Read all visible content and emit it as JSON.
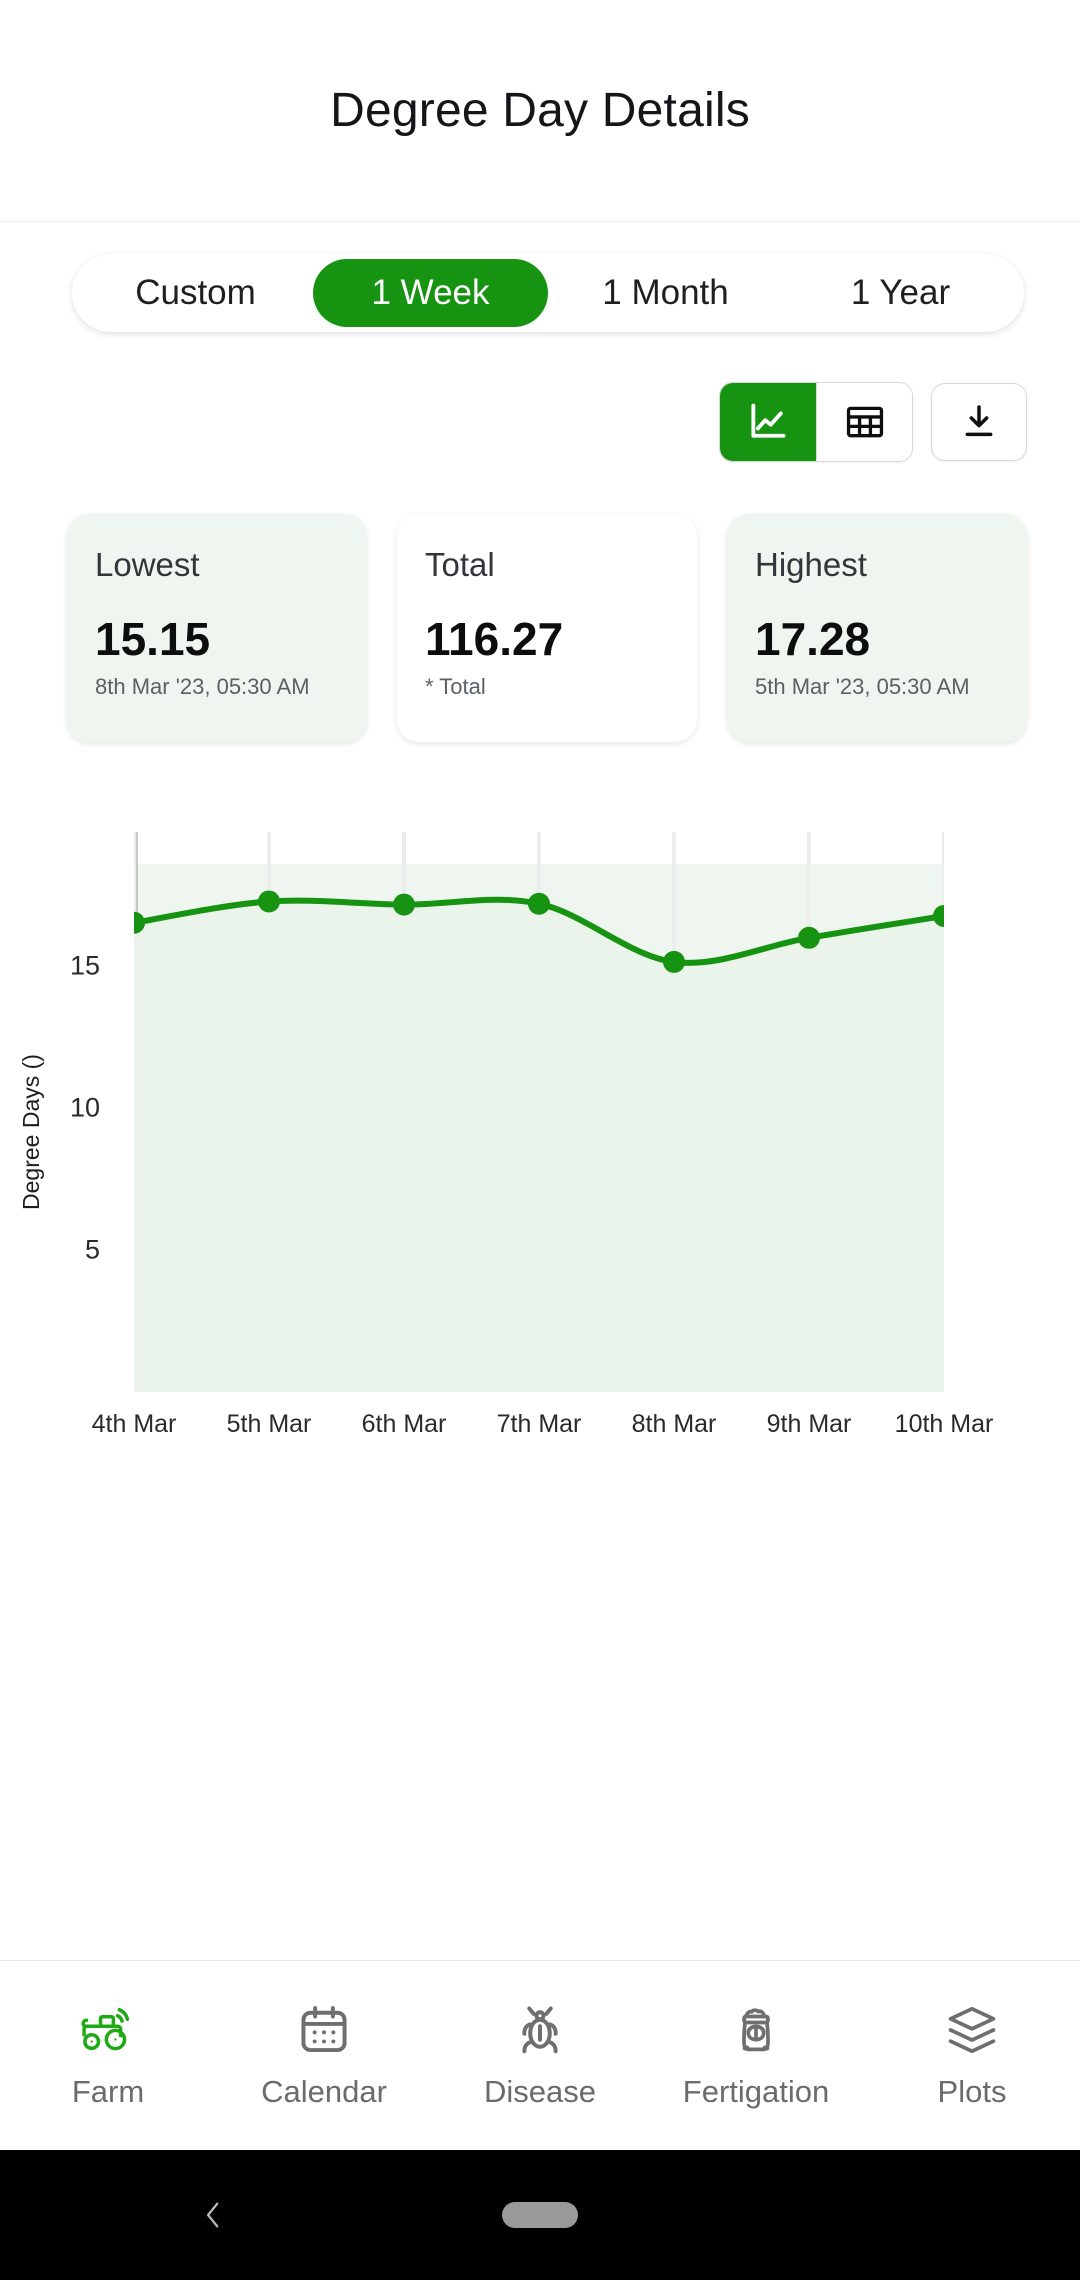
{
  "header": {
    "title": "Degree Day Details"
  },
  "range_tabs": [
    {
      "label": "Custom",
      "active": false
    },
    {
      "label": "1 Week",
      "active": true
    },
    {
      "label": "1 Month",
      "active": false
    },
    {
      "label": "1 Year",
      "active": false
    }
  ],
  "toolbar": {
    "chart_view": {
      "icon": "line-chart-icon",
      "active": true
    },
    "table_view": {
      "icon": "table-icon",
      "active": false
    },
    "download": {
      "icon": "download-icon"
    }
  },
  "stats": [
    {
      "label": "Lowest",
      "value": "15.15",
      "sub": "8th Mar '23, 05:30 AM",
      "tint": true
    },
    {
      "label": "Total",
      "value": "116.27",
      "sub": "* Total",
      "tint": false
    },
    {
      "label": "Highest",
      "value": "17.28",
      "sub": "5th Mar '23, 05:30 AM",
      "tint": true
    }
  ],
  "colors": {
    "accent": "#169310",
    "card_tint": "#eef6ef",
    "plot_fill": "#eff6ef",
    "axis": "#c8c8c8",
    "nav_inactive": "#6b6b6b"
  },
  "chart_data": {
    "type": "line",
    "title": "",
    "xlabel": "",
    "ylabel": "Degree Days ()",
    "categories": [
      "4th Mar",
      "5th Mar",
      "6th Mar",
      "7th Mar",
      "8th Mar",
      "9th Mar",
      "10th Mar"
    ],
    "values": [
      16.53,
      17.28,
      17.17,
      17.2,
      15.15,
      16.0,
      16.77
    ],
    "series": [
      {
        "name": "Degree Days",
        "values": [
          16.53,
          17.28,
          17.17,
          17.2,
          15.15,
          16.0,
          16.77
        ]
      }
    ],
    "ylim": [
      0,
      18.6
    ],
    "yticks": [
      5,
      10,
      15
    ],
    "ytick_labels": [
      "5",
      "10",
      "15"
    ],
    "grid": true,
    "legend": false,
    "line_color": "#169310",
    "area_fill": "#eaf4ea",
    "marker": "circle"
  },
  "bottom_nav": [
    {
      "label": "Farm",
      "icon": "tractor-icon",
      "active": true
    },
    {
      "label": "Calendar",
      "icon": "calendar-icon",
      "active": false
    },
    {
      "label": "Disease",
      "icon": "bug-icon",
      "active": false
    },
    {
      "label": "Fertigation",
      "icon": "fertilizer-bag-icon",
      "active": false
    },
    {
      "label": "Plots",
      "icon": "layers-icon",
      "active": false
    }
  ],
  "system_bar": {
    "back": "back-chevron-icon",
    "home": "home-pill-icon"
  }
}
